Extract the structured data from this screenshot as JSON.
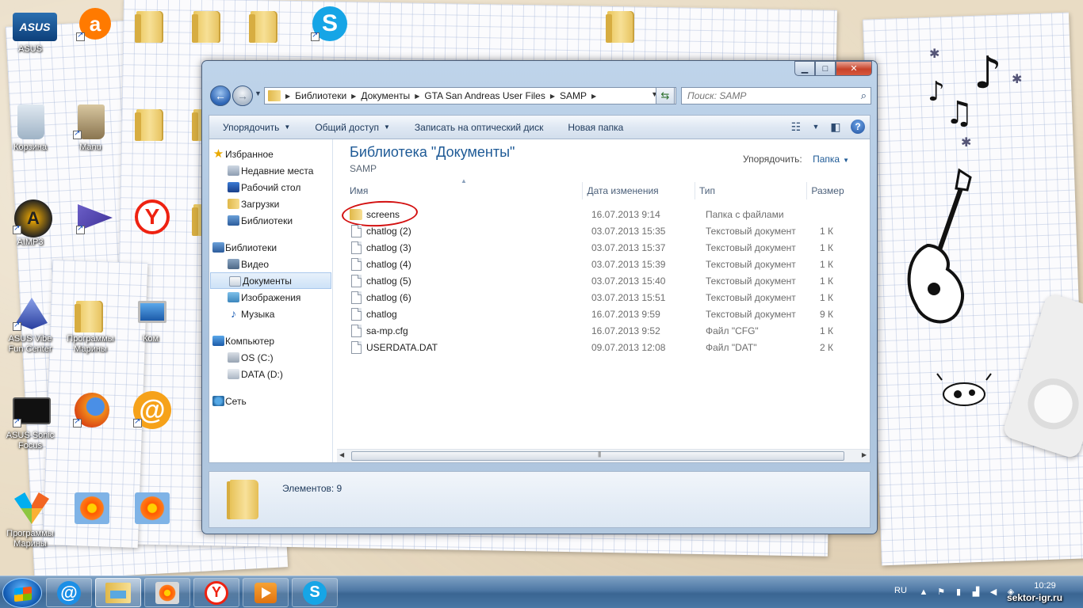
{
  "desktop": {
    "icons": [
      {
        "label": "ASUS"
      },
      {
        "label": ""
      },
      {
        "label": "Корзина"
      },
      {
        "label": "Manu"
      },
      {
        "label": "AIMP3"
      },
      {
        "label": "ASUS Vibe Fun Center"
      },
      {
        "label": "Программы Марины"
      },
      {
        "label": "Ком"
      },
      {
        "label": "ASUS Sonic Focus"
      },
      {
        "label": "Программы Марины"
      }
    ]
  },
  "window": {
    "controls": {
      "minimize": "▁",
      "maximize": "□",
      "close": "✕"
    },
    "address": {
      "crumbs": [
        "Библиотеки",
        "Документы",
        "GTA San Andreas User Files",
        "SAMP"
      ]
    },
    "search": {
      "placeholder": "Поиск: SAMP"
    },
    "toolbar": {
      "organize": "Упорядочить",
      "share": "Общий доступ",
      "burn": "Записать на оптический диск",
      "new_folder": "Новая папка"
    },
    "nav": {
      "favorites": "Избранное",
      "recent": "Недавние места",
      "desktop": "Рабочий стол",
      "downloads": "Загрузки",
      "libraries_fav": "Библиотеки",
      "libraries": "Библиотеки",
      "video": "Видео",
      "documents": "Документы",
      "images": "Изображения",
      "music": "Музыка",
      "computer": "Компьютер",
      "os_c": "OS (C:)",
      "data_d": "DATA (D:)",
      "network": "Сеть"
    },
    "content": {
      "title": "Библиотека \"Документы\"",
      "subtitle": "SAMP",
      "arrange_label": "Упорядочить:",
      "arrange_value": "Папка",
      "columns": {
        "name": "Имя",
        "date": "Дата изменения",
        "type": "Тип",
        "size": "Размер"
      },
      "files": [
        {
          "name": "screens",
          "kind": "folder",
          "date": "16.07.2013 9:14",
          "type": "Папка с файлами",
          "size": ""
        },
        {
          "name": "chatlog (2)",
          "kind": "file",
          "date": "03.07.2013 15:35",
          "type": "Текстовый документ",
          "size": "1 К"
        },
        {
          "name": "chatlog (3)",
          "kind": "file",
          "date": "03.07.2013 15:37",
          "type": "Текстовый документ",
          "size": "1 К"
        },
        {
          "name": "chatlog (4)",
          "kind": "file",
          "date": "03.07.2013 15:39",
          "type": "Текстовый документ",
          "size": "1 К"
        },
        {
          "name": "chatlog (5)",
          "kind": "file",
          "date": "03.07.2013 15:40",
          "type": "Текстовый документ",
          "size": "1 К"
        },
        {
          "name": "chatlog (6)",
          "kind": "file",
          "date": "03.07.2013 15:51",
          "type": "Текстовый документ",
          "size": "1 К"
        },
        {
          "name": "chatlog",
          "kind": "file",
          "date": "16.07.2013 9:59",
          "type": "Текстовый документ",
          "size": "9 К"
        },
        {
          "name": "sa-mp.cfg",
          "kind": "file",
          "date": "16.07.2013 9:52",
          "type": "Файл \"CFG\"",
          "size": "1 К"
        },
        {
          "name": "USERDATA.DAT",
          "kind": "file",
          "date": "09.07.2013 12:08",
          "type": "Файл \"DAT\"",
          "size": "2 К"
        }
      ]
    },
    "details": {
      "count": "Элементов: 9"
    }
  },
  "taskbar": {
    "lang": "RU",
    "clock": "10:29",
    "watermark": "sektor-igr.ru"
  },
  "colors": {
    "accent_title": "#1e5a96",
    "annotation_ring": "#d31010",
    "taskbar": "#4d77a4"
  }
}
